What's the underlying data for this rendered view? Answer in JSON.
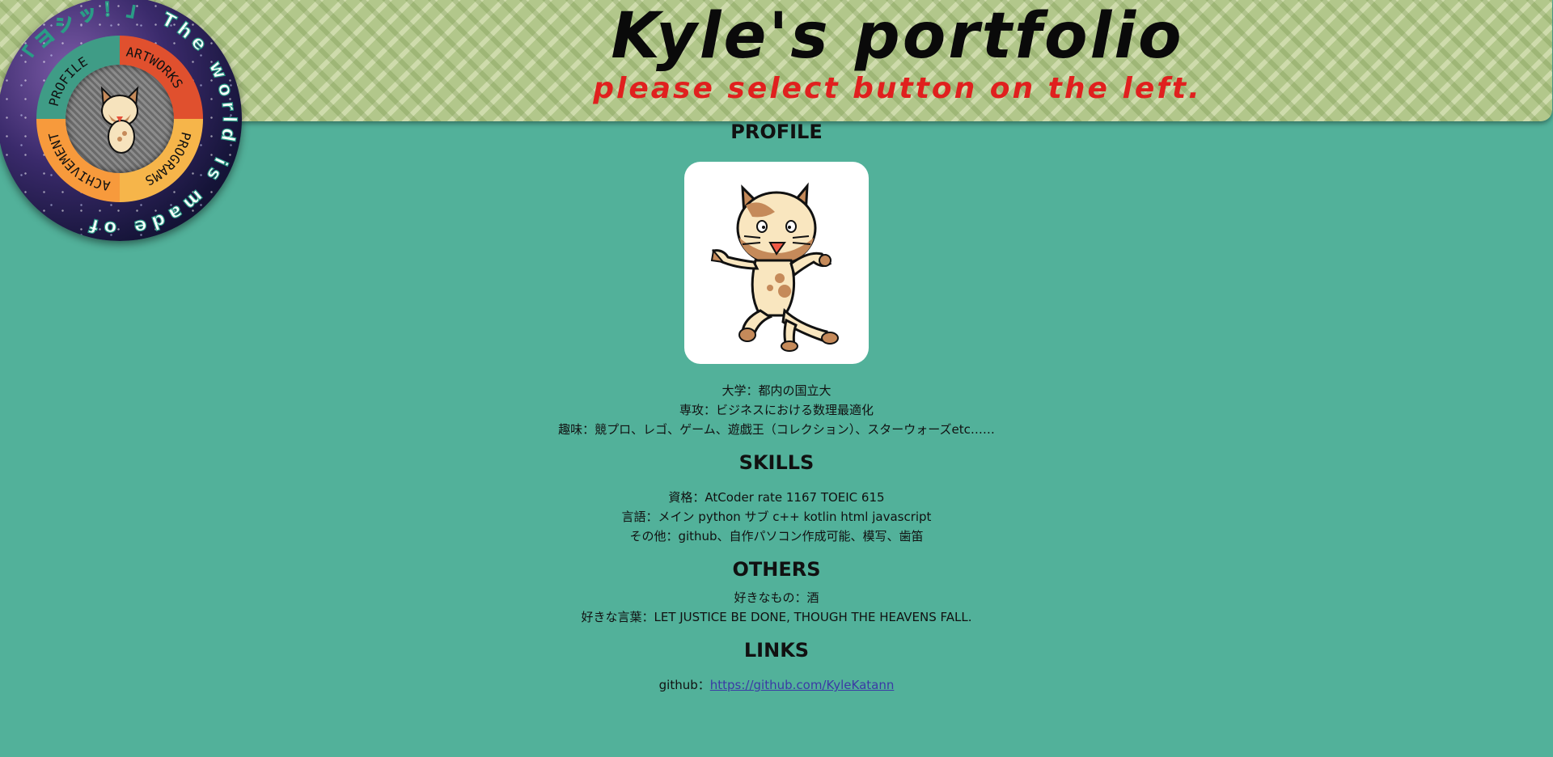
{
  "header": {
    "title": "Kyle's portfolio",
    "subtitle": "please select button on the left."
  },
  "nav": {
    "ring_text": "「ヨシッ！」 The world is made of",
    "items": [
      {
        "label": "PROFILE"
      },
      {
        "label": "ARTWORKS"
      },
      {
        "label": "PROGRAMS"
      },
      {
        "label": "ACHIVEMENT"
      }
    ]
  },
  "profile": {
    "heading": "PROFILE",
    "lines": [
      "大学：都内の国立大",
      "専攻：ビジネスにおける数理最適化",
      "趣味：競プロ、レゴ、ゲーム、遊戯王（コレクション）、スターウォーズetc……"
    ]
  },
  "skills": {
    "heading": "SKILLS",
    "lines": [
      "資格：AtCoder rate 1167 TOEIC 615",
      "言語：メイン python サブ c++ kotlin html javascript",
      "その他：github、自作パソコン作成可能、模写、歯笛"
    ]
  },
  "others": {
    "heading": "OTHERS",
    "lines": [
      "好きなもの：酒",
      "好きな言葉：LET JUSTICE BE DONE, THOUGH THE HEAVENS FALL."
    ]
  },
  "links": {
    "heading": "LINKS",
    "github_label": "github：",
    "github_url": "https://github.com/KyleKatann"
  },
  "colors": {
    "background": "#52b19a",
    "subtitle_red": "#e0201e",
    "menu_profile": "#3f9c86",
    "menu_artworks": "#e0502e",
    "menu_programs": "#f6b54a",
    "menu_achivement": "#f79a3c"
  }
}
